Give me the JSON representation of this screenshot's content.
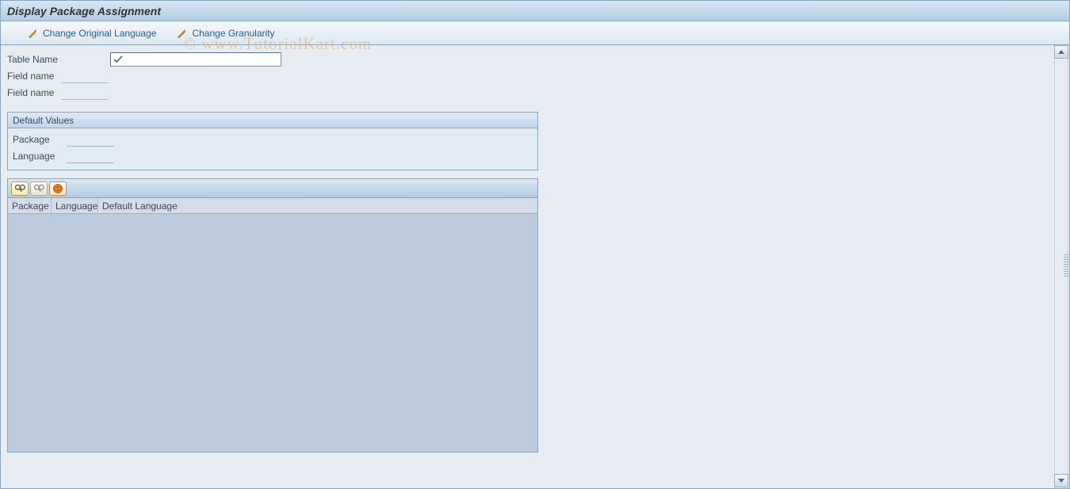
{
  "header": {
    "title": "Display Package Assignment"
  },
  "toolbar": {
    "change_lang_label": "Change Original Language",
    "change_gran_label": "Change Granularity"
  },
  "form": {
    "table_name_label": "Table Name",
    "table_name_value": "",
    "field_name_label_1": "Field name",
    "field_name_label_2": "Field name"
  },
  "default_values_group": {
    "title": "Default Values",
    "package_label": "Package",
    "language_label": "Language"
  },
  "table": {
    "columns": [
      "Package",
      "Language",
      "Default Language"
    ]
  },
  "watermark": "© www.TutorialKart.com",
  "icons": {
    "edit": "edit-icon",
    "pencil": "pencil-icon",
    "find": "find-icon",
    "find_next": "find-next-icon",
    "globe": "globe-icon",
    "check": "check-icon"
  }
}
